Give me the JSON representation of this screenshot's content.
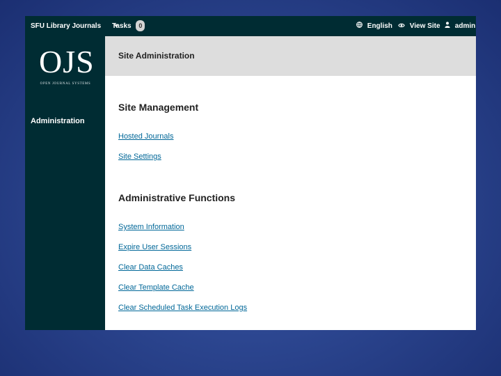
{
  "topbar": {
    "journal_switcher": "SFU Library Journals",
    "tasks_label": "Tasks",
    "tasks_count": "0",
    "language": "English",
    "view_site": "View Site",
    "user": "admin"
  },
  "sidebar": {
    "logo_text": "OJS",
    "logo_subtitle": "OPEN JOURNAL SYSTEMS",
    "nav_administration": "Administration"
  },
  "main": {
    "page_title": "Site Administration",
    "site_management": {
      "title": "Site Management",
      "links": [
        "Hosted Journals",
        "Site Settings"
      ]
    },
    "admin_functions": {
      "title": "Administrative Functions",
      "links": [
        "System Information",
        "Expire User Sessions",
        "Clear Data Caches",
        "Clear Template Cache",
        "Clear Scheduled Task Execution Logs"
      ]
    }
  },
  "colors": {
    "nav_bg": "#002c33",
    "link": "#006798",
    "header_bg": "#dddddd",
    "slide_bg": "#2c4690"
  }
}
